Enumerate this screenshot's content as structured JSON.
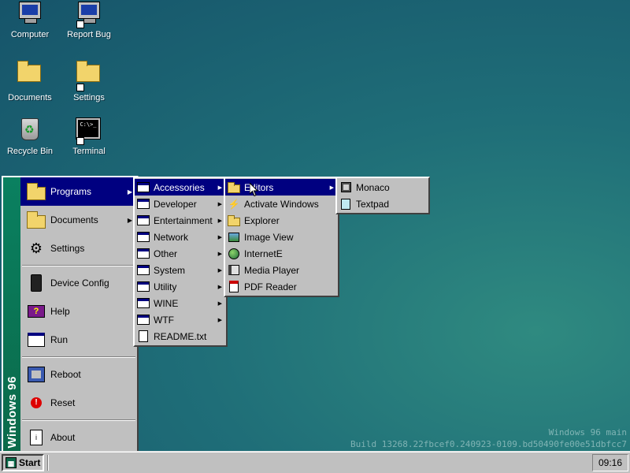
{
  "desktop": {
    "icons": [
      {
        "label": "Computer",
        "icon": "computer-icon"
      },
      {
        "label": "Report Bug",
        "icon": "report-bug-icon"
      },
      {
        "label": "Documents",
        "icon": "folder-icon"
      },
      {
        "label": "Settings",
        "icon": "settings-folder-icon"
      },
      {
        "label": "Recycle Bin",
        "icon": "recycle-bin-icon"
      },
      {
        "label": "Terminal",
        "icon": "terminal-icon"
      }
    ],
    "watermark": {
      "line1": "Windows 96 main",
      "line2": "Build 13268.22fbcef0.240923-0109.bd50490fe00e51dbfcc7"
    }
  },
  "start_menu": {
    "brand": "Windows 96",
    "items": [
      {
        "label": "Programs",
        "icon": "programs-folder-icon",
        "submenu": true
      },
      {
        "label": "Documents",
        "icon": "documents-folder-icon",
        "submenu": true
      },
      {
        "label": "Settings",
        "icon": "settings-icon",
        "submenu": false
      },
      {
        "label": "Device Config",
        "icon": "device-icon",
        "submenu": false
      },
      {
        "label": "Help",
        "icon": "help-book-icon",
        "submenu": false
      },
      {
        "label": "Run",
        "icon": "run-icon",
        "submenu": false
      },
      {
        "label": "Reboot",
        "icon": "reboot-icon",
        "submenu": false
      },
      {
        "label": "Reset",
        "icon": "reset-icon",
        "submenu": false
      },
      {
        "label": "About",
        "icon": "about-icon",
        "submenu": false
      }
    ]
  },
  "programs_menu": {
    "items": [
      {
        "label": "Accessories",
        "icon": "program-group-icon",
        "submenu": true
      },
      {
        "label": "Developer",
        "icon": "program-group-icon",
        "submenu": true
      },
      {
        "label": "Entertainment",
        "icon": "program-group-icon",
        "submenu": true
      },
      {
        "label": "Network",
        "icon": "program-group-icon",
        "submenu": true
      },
      {
        "label": "Other",
        "icon": "program-group-icon",
        "submenu": true
      },
      {
        "label": "System",
        "icon": "program-group-icon",
        "submenu": true
      },
      {
        "label": "Utility",
        "icon": "program-group-icon",
        "submenu": true
      },
      {
        "label": "WINE",
        "icon": "program-group-icon",
        "submenu": true
      },
      {
        "label": "WTF",
        "icon": "program-group-icon",
        "submenu": true
      },
      {
        "label": "README.txt",
        "icon": "text-file-icon",
        "submenu": false
      }
    ]
  },
  "accessories_menu": {
    "items": [
      {
        "label": "Editors",
        "icon": "folder-icon",
        "submenu": true
      },
      {
        "label": "Activate Windows",
        "icon": "activate-icon",
        "submenu": false
      },
      {
        "label": "Explorer",
        "icon": "explorer-icon",
        "submenu": false
      },
      {
        "label": "Image View",
        "icon": "image-view-icon",
        "submenu": false
      },
      {
        "label": "InternetE",
        "icon": "globe-icon",
        "submenu": false
      },
      {
        "label": "Media Player",
        "icon": "media-player-icon",
        "submenu": false
      },
      {
        "label": "PDF Reader",
        "icon": "pdf-icon",
        "submenu": false
      }
    ]
  },
  "editors_menu": {
    "items": [
      {
        "label": "Monaco",
        "icon": "monaco-icon"
      },
      {
        "label": "Textpad",
        "icon": "textpad-icon"
      }
    ]
  },
  "taskbar": {
    "start_label": "Start",
    "clock": "09:16"
  },
  "colors": {
    "highlight": "#000080",
    "brand_bar": "#0b6a4a",
    "face": "#c0c0c0"
  }
}
